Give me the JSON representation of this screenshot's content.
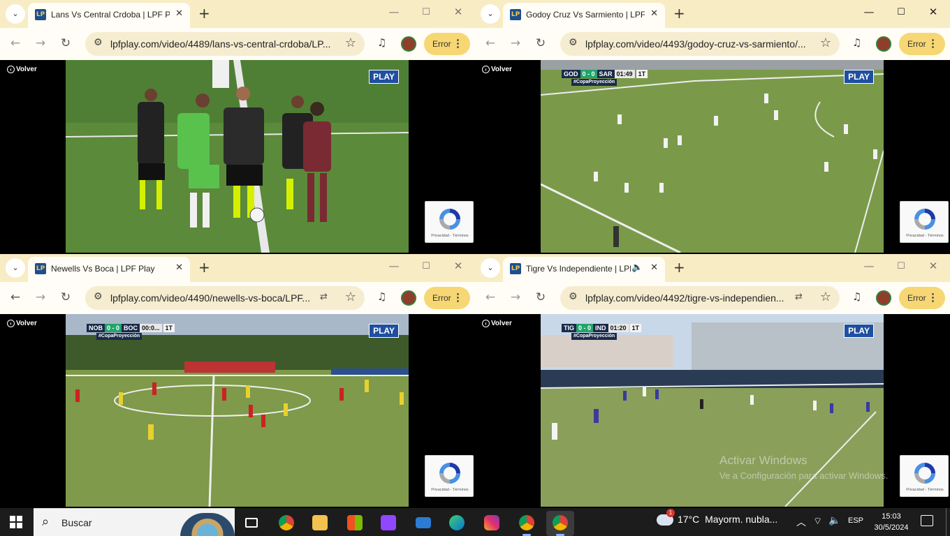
{
  "windows": [
    {
      "tab_title": "Lans Vs Central Crdoba | LPF Pla",
      "url": "lpfplay.com/video/4489/lans-vs-central-crdoba/LP...",
      "has_translate": false,
      "has_sound": false,
      "back_enabled": false,
      "volver": "Volver",
      "play_logo": "PLAY",
      "scorebug": null,
      "recaptcha": "Privacidad - Términos",
      "error_label": "Error"
    },
    {
      "tab_title": "Godoy Cruz Vs Sarmiento | LPF",
      "url": "lpfplay.com/video/4493/godoy-cruz-vs-sarmiento/...",
      "has_translate": false,
      "has_sound": false,
      "back_enabled": false,
      "volver": "Volver",
      "play_logo": "PLAY",
      "scorebug": {
        "home": "GOD",
        "score": "0 - 0",
        "away": "SAR",
        "time": "01:49",
        "period": "1T",
        "tag": "#CopaProyección"
      },
      "recaptcha": "Privacidad - Términos",
      "error_label": "Error"
    },
    {
      "tab_title": "Newells Vs Boca | LPF Play",
      "url": "lpfplay.com/video/4490/newells-vs-boca/LPF...",
      "has_translate": true,
      "has_sound": false,
      "back_enabled": true,
      "volver": "Volver",
      "play_logo": "PLAY",
      "scorebug": {
        "home": "NOB",
        "score": "0 - 0",
        "away": "BOC",
        "time": "00:0...",
        "period": "1T",
        "tag": "#CopaProyección"
      },
      "recaptcha": "Privacidad - Términos",
      "error_label": "Error"
    },
    {
      "tab_title": "Tigre Vs Independiente | LPF",
      "url": "lpfplay.com/video/4492/tigre-vs-independien...",
      "has_translate": true,
      "has_sound": true,
      "back_enabled": false,
      "volver": "Volver",
      "play_logo": "PLAY",
      "scorebug": {
        "home": "TIG",
        "score": "0 - 0",
        "away": "IND",
        "time": "01:20",
        "period": "1T",
        "tag": "#CopaProyección"
      },
      "recaptcha": "Privacidad - Términos",
      "error_label": "Error"
    }
  ],
  "watermark": {
    "line1": "Activar Windows",
    "line2": "Ve a Configuración para activar Windows."
  },
  "taskbar": {
    "search_placeholder": "Buscar",
    "apps": [
      "task-view",
      "chrome",
      "file-explorer",
      "microsoft-store",
      "twitch",
      "mail",
      "edge",
      "instagram",
      "chrome-profile",
      "chrome-active"
    ],
    "weather_temp": "17°C",
    "weather_text": "Mayorm. nubla...",
    "weather_badge": "1",
    "lang": "ESP",
    "time": "15:03",
    "date": "30/5/2024"
  }
}
